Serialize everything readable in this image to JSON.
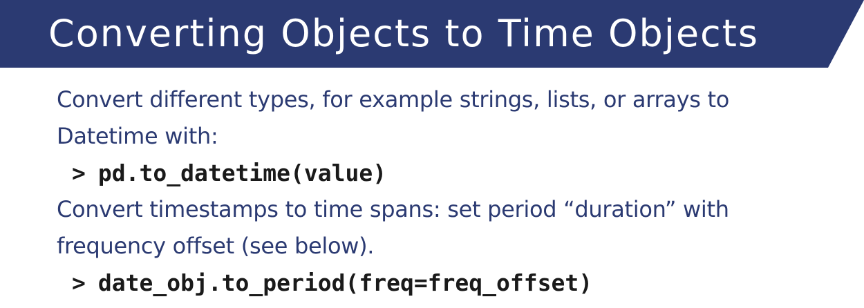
{
  "slide": {
    "title": "Converting Objects to Time Objects",
    "banner_color": "#2b3a72",
    "text_color": "#2b3a72",
    "paragraph1": {
      "line1": "Convert different types, for example strings, lists, or arrays to",
      "line2": "Datetime with:"
    },
    "code1": {
      "prompt": ">",
      "text": "pd.to_datetime(value)"
    },
    "paragraph2": {
      "line1": "Convert timestamps to time spans: set period “duration” with",
      "line2": "frequency offset (see below)."
    },
    "code2": {
      "prompt": ">",
      "text": "date_obj.to_period(freq=freq_offset)"
    }
  }
}
